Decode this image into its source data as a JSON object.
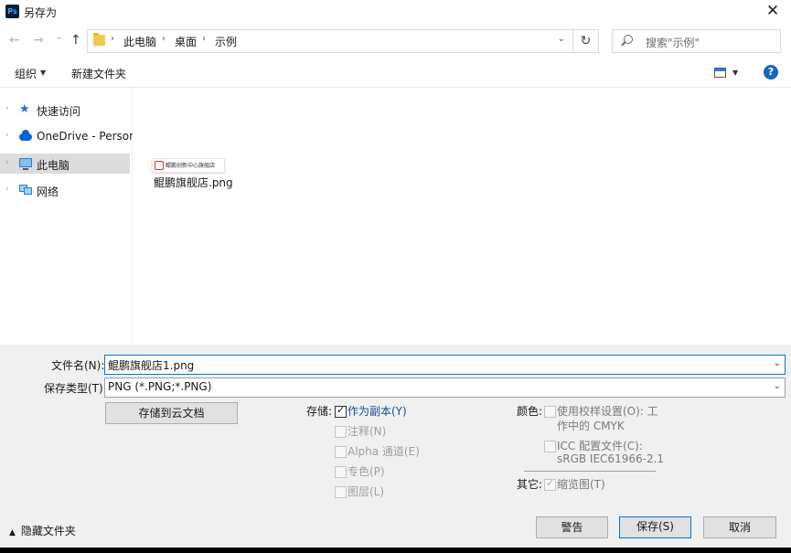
{
  "window": {
    "app_icon": "photoshop-icon",
    "title": "另存为",
    "close": "✕"
  },
  "nav": {
    "back": "←",
    "forward": "→",
    "recent": "⌄",
    "up": "↑"
  },
  "address": {
    "crumbs": [
      "此电脑",
      "桌面",
      "示例"
    ],
    "separator": "›",
    "dropdown": "⌄",
    "refresh": "↻"
  },
  "search": {
    "placeholder": "搜索\"示例\""
  },
  "toolbar": {
    "organize": "组织",
    "organize_caret": "▼",
    "new_folder": "新建文件夹",
    "view_caret": "▼",
    "help": "?"
  },
  "sidebar": {
    "items": [
      {
        "label": "快速访问",
        "icon": "star-icon",
        "chevron": "›"
      },
      {
        "label": "OneDrive - Persona",
        "icon": "cloud-icon",
        "chevron": "›"
      },
      {
        "label": "此电脑",
        "icon": "computer-icon",
        "chevron": "›",
        "selected": true
      },
      {
        "label": "网络",
        "icon": "network-icon",
        "chevron": "›"
      }
    ]
  },
  "files": [
    {
      "name": "鲲鹏旗舰店.png",
      "thumb_text": "鲲鹏创新中心旗舰店"
    }
  ],
  "form": {
    "filename_label": "文件名(N):",
    "filename_value": "鲲鹏旗舰店1.png",
    "filetype_label": "保存类型(T):",
    "filetype_value": "PNG (*.PNG;*.PNG)",
    "drop": "⌄",
    "cloud_button": "存储到云文档"
  },
  "save_options": {
    "group_label": "存储:",
    "items": [
      {
        "label": "作为副本(Y)",
        "checked": true,
        "enabled": true
      },
      {
        "label": "注释(N)",
        "checked": false,
        "enabled": false
      },
      {
        "label": "Alpha 通道(E)",
        "checked": false,
        "enabled": false
      },
      {
        "label": "专色(P)",
        "checked": false,
        "enabled": false
      },
      {
        "label": "图层(L)",
        "checked": false,
        "enabled": false
      }
    ]
  },
  "color_options": {
    "group_label": "颜色:",
    "proof_line1": "使用校样设置(O):  工",
    "proof_line2": "作中的 CMYK",
    "icc_line1": "ICC 配置文件(C):",
    "icc_line2": "sRGB IEC61966-2.1"
  },
  "other_options": {
    "group_label": "其它:",
    "thumbnail": "缩览图(T)",
    "check": "✓"
  },
  "footer": {
    "hide_folders": "隐藏文件夹",
    "hide_caret": "▲",
    "warning": "警告",
    "save": "保存(S)",
    "cancel": "取消"
  }
}
